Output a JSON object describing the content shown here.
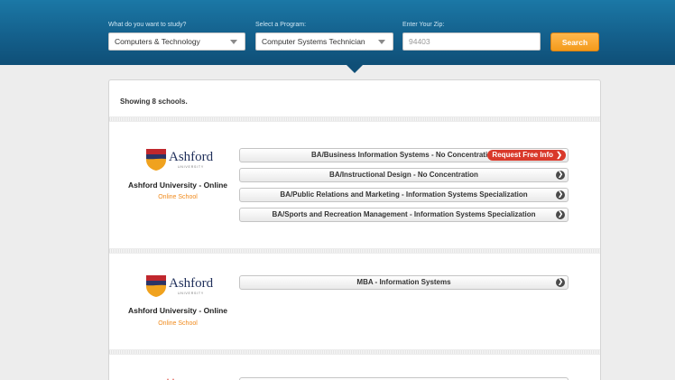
{
  "search": {
    "study_label": "What do you want to study?",
    "study_value": "Computers & Technology",
    "program_label": "Select a Program:",
    "program_value": "Computer Systems Technician",
    "zip_label": "Enter Your Zip:",
    "zip_value": "94403",
    "search_button": "Search"
  },
  "results": {
    "showing": "Showing 8 schools."
  },
  "schools": [
    {
      "logo_word": "Ashford",
      "logo_sub": "UNIVERSITY",
      "name": "Ashford University - Online",
      "type": "Online School",
      "programs": [
        "BA/Business Information Systems - No Concentration",
        "BA/Instructional Design - No Concentration",
        "BA/Public Relations and Marketing - Information Systems Specialization",
        "BA/Sports and Recreation Management - Information Systems Specialization"
      ],
      "request_label": "Request Free Info"
    },
    {
      "logo_word": "Ashford",
      "logo_sub": "UNIVERSITY",
      "name": "Ashford University - Online",
      "type": "Online School",
      "programs": [
        "MBA - Information Systems"
      ]
    }
  ],
  "colors": {
    "header": "#14608c",
    "accent_orange": "#f39a1b",
    "request_red": "#d9392b"
  }
}
